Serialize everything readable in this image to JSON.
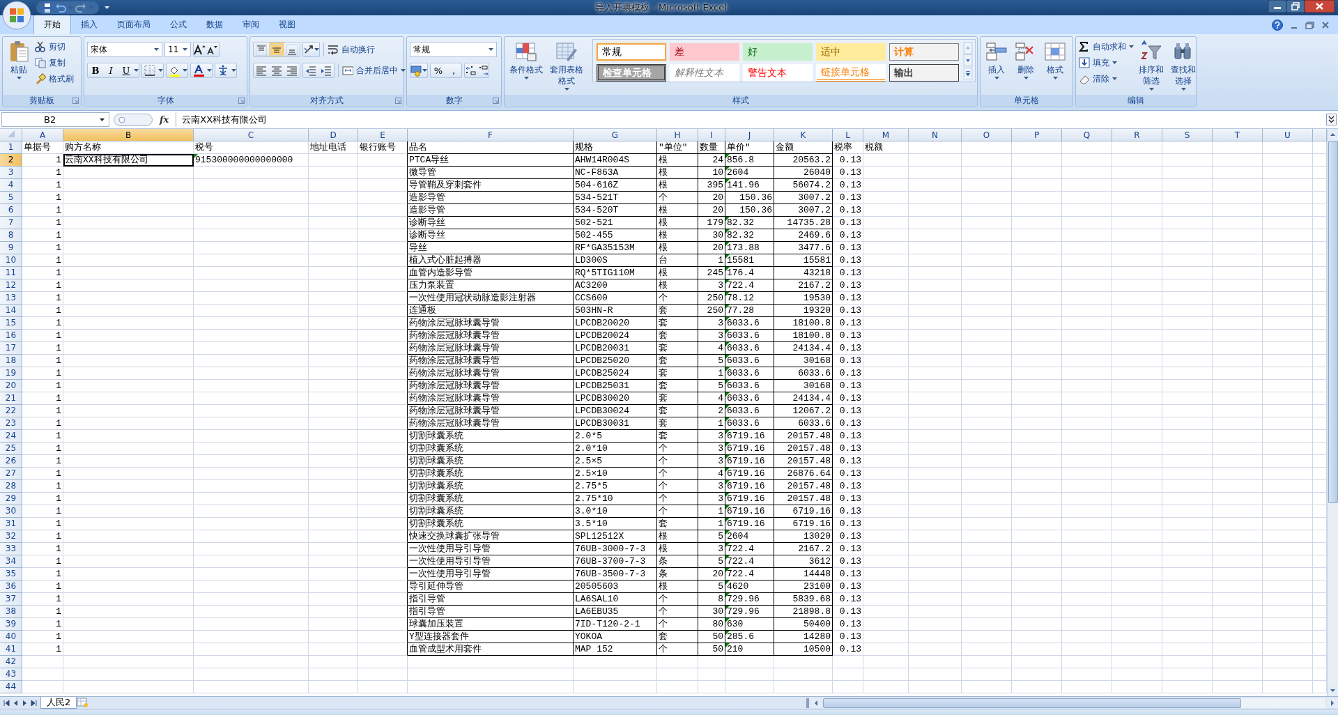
{
  "window": {
    "title": "导入开票模板 - Microsoft Excel"
  },
  "tabs": [
    {
      "label": "开始",
      "selected": true
    },
    {
      "label": "插入",
      "selected": false
    },
    {
      "label": "页面布局",
      "selected": false
    },
    {
      "label": "公式",
      "selected": false
    },
    {
      "label": "数据",
      "selected": false
    },
    {
      "label": "审阅",
      "selected": false
    },
    {
      "label": "视图",
      "selected": false
    }
  ],
  "ribbon": {
    "groups": [
      {
        "kind": "clipboard",
        "label": "剪贴板",
        "launcher": true,
        "paste": "粘贴",
        "items": [
          "剪切",
          "复制",
          "格式刷"
        ]
      },
      {
        "kind": "font",
        "label": "字体",
        "launcher": true,
        "font": "宋体",
        "size": "11",
        "styles": [
          "B",
          "I",
          "U"
        ]
      },
      {
        "kind": "alignment",
        "label": "对齐方式",
        "launcher": true,
        "vertical": [
          {
            "selected": false
          },
          {
            "selected": true
          },
          {
            "selected": false
          }
        ],
        "wrap": "自动换行",
        "merge": "合并后居中"
      },
      {
        "kind": "number",
        "label": "数字",
        "launcher": true,
        "format": "常规",
        "symbols": [
          "%",
          ","
        ]
      },
      {
        "kind": "styles",
        "label": "样式",
        "launcher": false,
        "buttons": [
          "条件格式",
          "套用表格格式"
        ],
        "cell_styles": [
          {
            "label": "常规",
            "kind": "normal",
            "selected": true
          },
          {
            "label": "差",
            "kind": "bad",
            "selected": false
          },
          {
            "label": "好",
            "kind": "good",
            "selected": false
          },
          {
            "label": "适中",
            "kind": "neutral",
            "selected": false
          },
          {
            "label": "计算",
            "kind": "calculation",
            "selected": false
          },
          {
            "label": "检查单元格",
            "kind": "check",
            "selected": false
          },
          {
            "label": "解释性文本",
            "kind": "explanatory",
            "selected": false
          },
          {
            "label": "警告文本",
            "kind": "warning",
            "selected": false
          },
          {
            "label": "链接单元格",
            "kind": "linked",
            "selected": false
          },
          {
            "label": "输出",
            "kind": "output",
            "selected": false
          }
        ]
      },
      {
        "kind": "cells",
        "label": "单元格",
        "launcher": false,
        "buttons": [
          "插入",
          "删除",
          "格式"
        ]
      },
      {
        "kind": "editing",
        "label": "编辑",
        "launcher": false,
        "items": [
          "自动求和",
          "填充",
          "清除"
        ],
        "buttons": [
          "排序和筛选",
          "查找和选择"
        ]
      }
    ]
  },
  "formula_bar": {
    "name_box": "B2",
    "fx": "fx",
    "value": "云南XX科技有限公司"
  },
  "sheet": {
    "columns": [
      {
        "letter": "A",
        "selected": false,
        "kind": "number",
        "boxed": false
      },
      {
        "letter": "B",
        "selected": true,
        "kind": "text",
        "boxed": false
      },
      {
        "letter": "C",
        "selected": false,
        "kind": "text_number",
        "boxed": false
      },
      {
        "letter": "D",
        "selected": false,
        "kind": "text",
        "boxed": false
      },
      {
        "letter": "E",
        "selected": false,
        "kind": "text",
        "boxed": false
      },
      {
        "letter": "F",
        "selected": false,
        "kind": "text",
        "boxed": true
      },
      {
        "letter": "G",
        "selected": false,
        "kind": "text",
        "boxed": true
      },
      {
        "letter": "H",
        "selected": false,
        "kind": "text",
        "boxed": true
      },
      {
        "letter": "I",
        "selected": false,
        "kind": "number",
        "boxed": true
      },
      {
        "letter": "J",
        "selected": false,
        "kind": "text_number",
        "boxed": true
      },
      {
        "letter": "K",
        "selected": false,
        "kind": "number",
        "boxed": true
      },
      {
        "letter": "L",
        "selected": false,
        "kind": "number",
        "boxed": false
      },
      {
        "letter": "M",
        "selected": false,
        "kind": "text",
        "boxed": false
      },
      {
        "letter": "N",
        "selected": false
      },
      {
        "letter": "O",
        "selected": false
      },
      {
        "letter": "P",
        "selected": false
      },
      {
        "letter": "Q",
        "selected": false
      },
      {
        "letter": "R",
        "selected": false
      },
      {
        "letter": "S",
        "selected": false
      },
      {
        "letter": "T",
        "selected": false
      },
      {
        "letter": "U",
        "selected": false
      }
    ],
    "rows": [
      {
        "number": "1",
        "selected": false,
        "cells": {
          "A": "单据号",
          "B": "购方名称",
          "C": "税号",
          "D": "地址电话",
          "E": "银行账号",
          "F": "品名",
          "G": "规格",
          "H": "″单位″",
          "I": "数量",
          "J": "单价″",
          "K": "金额",
          "L": "税率",
          "M": "税额"
        }
      },
      {
        "number": "2",
        "selected": true,
        "numbers_as_text": true,
        "cells": {
          "A": "1",
          "B": "云南XX科技有限公司",
          "C": "915300000000000000",
          "F": "PTCA导丝",
          "G": "AHW14R004S",
          "H": "根",
          "I": "24",
          "J": "856.8",
          "K": "20563.2",
          "L": "0.13"
        }
      },
      {
        "number": "3",
        "selected": false,
        "numbers_as_text": true,
        "cells": {
          "A": "1",
          "F": "微导管",
          "G": "NC-F863A",
          "H": "根",
          "I": "10",
          "J": "2604",
          "K": "26040",
          "L": "0.13"
        }
      },
      {
        "number": "4",
        "selected": false,
        "numbers_as_text": true,
        "cells": {
          "A": "1",
          "F": "导管鞘及穿刺套件",
          "G": "504-616Z",
          "H": "根",
          "I": "395",
          "J": "141.96",
          "K": "56074.2",
          "L": "0.13"
        }
      },
      {
        "number": "5",
        "selected": false,
        "numbers_as_text": false,
        "cells": {
          "A": "1",
          "F": "造影导管",
          "G": "534-521T",
          "H": "个",
          "I": "20",
          "J": "150.36",
          "K": "3007.2",
          "L": "0.13"
        }
      },
      {
        "number": "6",
        "selected": false,
        "numbers_as_text": false,
        "cells": {
          "A": "1",
          "F": "造影导管",
          "G": "534-520T",
          "H": "根",
          "I": "20",
          "J": "150.36",
          "K": "3007.2",
          "L": "0.13"
        }
      },
      {
        "number": "7",
        "selected": false,
        "numbers_as_text": true,
        "cells": {
          "A": "1",
          "F": "诊断导丝",
          "G": "502-521",
          "H": "根",
          "I": "179",
          "J": "82.32",
          "K": "14735.28",
          "L": "0.13"
        }
      },
      {
        "number": "8",
        "selected": false,
        "numbers_as_text": true,
        "cells": {
          "A": "1",
          "F": "诊断导丝",
          "G": "502-455",
          "H": "根",
          "I": "30",
          "J": "82.32",
          "K": "2469.6",
          "L": "0.13"
        }
      },
      {
        "number": "9",
        "selected": false,
        "numbers_as_text": true,
        "cells": {
          "A": "1",
          "F": "导丝",
          "G": "RF*GA35153M",
          "H": "根",
          "I": "20",
          "J": "173.88",
          "K": "3477.6",
          "L": "0.13"
        }
      },
      {
        "number": "10",
        "selected": false,
        "numbers_as_text": true,
        "cells": {
          "A": "1",
          "F": "植入式心脏起搏器",
          "G": "LD300S",
          "H": "台",
          "I": "1",
          "J": "15581",
          "K": "15581",
          "L": "0.13"
        }
      },
      {
        "number": "11",
        "selected": false,
        "numbers_as_text": true,
        "cells": {
          "A": "1",
          "F": "血管内造影导管",
          "G": "RQ*5TIG110M",
          "H": "根",
          "I": "245",
          "J": "176.4",
          "K": "43218",
          "L": "0.13"
        }
      },
      {
        "number": "12",
        "selected": false,
        "numbers_as_text": true,
        "cells": {
          "A": "1",
          "F": "压力泵装置",
          "G": "AC3200",
          "H": "根",
          "I": "3",
          "J": "722.4",
          "K": "2167.2",
          "L": "0.13"
        }
      },
      {
        "number": "13",
        "selected": false,
        "numbers_as_text": true,
        "cells": {
          "A": "1",
          "F": "一次性使用冠状动脉造影注射器",
          "G": "CCS600",
          "H": "个",
          "I": "250",
          "J": "78.12",
          "K": "19530",
          "L": "0.13"
        }
      },
      {
        "number": "14",
        "selected": false,
        "numbers_as_text": true,
        "cells": {
          "A": "1",
          "F": "连通板",
          "G": "503HN-R",
          "H": "套",
          "I": "250",
          "J": "77.28",
          "K": "19320",
          "L": "0.13"
        }
      },
      {
        "number": "15",
        "selected": false,
        "numbers_as_text": true,
        "cells": {
          "A": "1",
          "F": "药物涂层冠脉球囊导管",
          "G": "LPCDB20020",
          "H": "套",
          "I": "3",
          "J": "6033.6",
          "K": "18100.8",
          "L": "0.13"
        }
      },
      {
        "number": "16",
        "selected": false,
        "numbers_as_text": true,
        "cells": {
          "A": "1",
          "F": "药物涂层冠脉球囊导管",
          "G": "LPCDB20024",
          "H": "套",
          "I": "3",
          "J": "6033.6",
          "K": "18100.8",
          "L": "0.13"
        }
      },
      {
        "number": "17",
        "selected": false,
        "numbers_as_text": true,
        "cells": {
          "A": "1",
          "F": "药物涂层冠脉球囊导管",
          "G": "LPCDB20031",
          "H": "套",
          "I": "4",
          "J": "6033.6",
          "K": "24134.4",
          "L": "0.13"
        }
      },
      {
        "number": "18",
        "selected": false,
        "numbers_as_text": true,
        "cells": {
          "A": "1",
          "F": "药物涂层冠脉球囊导管",
          "G": "LPCDB25020",
          "H": "套",
          "I": "5",
          "J": "6033.6",
          "K": "30168",
          "L": "0.13"
        }
      },
      {
        "number": "19",
        "selected": false,
        "numbers_as_text": true,
        "cells": {
          "A": "1",
          "F": "药物涂层冠脉球囊导管",
          "G": "LPCDB25024",
          "H": "套",
          "I": "1",
          "J": "6033.6",
          "K": "6033.6",
          "L": "0.13"
        }
      },
      {
        "number": "20",
        "selected": false,
        "numbers_as_text": true,
        "cells": {
          "A": "1",
          "F": "药物涂层冠脉球囊导管",
          "G": "LPCDB25031",
          "H": "套",
          "I": "5",
          "J": "6033.6",
          "K": "30168",
          "L": "0.13"
        }
      },
      {
        "number": "21",
        "selected": false,
        "numbers_as_text": true,
        "cells": {
          "A": "1",
          "F": "药物涂层冠脉球囊导管",
          "G": "LPCDB30020",
          "H": "套",
          "I": "4",
          "J": "6033.6",
          "K": "24134.4",
          "L": "0.13"
        }
      },
      {
        "number": "22",
        "selected": false,
        "numbers_as_text": true,
        "cells": {
          "A": "1",
          "F": "药物涂层冠脉球囊导管",
          "G": "LPCDB30024",
          "H": "套",
          "I": "2",
          "J": "6033.6",
          "K": "12067.2",
          "L": "0.13"
        }
      },
      {
        "number": "23",
        "selected": false,
        "numbers_as_text": true,
        "cells": {
          "A": "1",
          "F": "药物涂层冠脉球囊导管",
          "G": "LPCDB30031",
          "H": "套",
          "I": "1",
          "J": "6033.6",
          "K": "6033.6",
          "L": "0.13"
        }
      },
      {
        "number": "24",
        "selected": false,
        "numbers_as_text": true,
        "cells": {
          "A": "1",
          "F": "切割球囊系统",
          "G": "2.0*5",
          "H": "套",
          "I": "3",
          "J": "6719.16",
          "K": "20157.48",
          "L": "0.13"
        }
      },
      {
        "number": "25",
        "selected": false,
        "numbers_as_text": true,
        "cells": {
          "A": "1",
          "F": "切割球囊系统",
          "G": "2.0*10",
          "H": "个",
          "I": "3",
          "J": "6719.16",
          "K": "20157.48",
          "L": "0.13"
        }
      },
      {
        "number": "26",
        "selected": false,
        "numbers_as_text": true,
        "cells": {
          "A": "1",
          "F": "切割球囊系统",
          "G": "2.5×5",
          "H": "个",
          "I": "3",
          "J": "6719.16",
          "K": "20157.48",
          "L": "0.13"
        }
      },
      {
        "number": "27",
        "selected": false,
        "numbers_as_text": true,
        "cells": {
          "A": "1",
          "F": "切割球囊系统",
          "G": "2.5×10",
          "H": "个",
          "I": "4",
          "J": "6719.16",
          "K": "26876.64",
          "L": "0.13"
        }
      },
      {
        "number": "28",
        "selected": false,
        "numbers_as_text": true,
        "cells": {
          "A": "1",
          "F": "切割球囊系统",
          "G": "2.75*5",
          "H": "个",
          "I": "3",
          "J": "6719.16",
          "K": "20157.48",
          "L": "0.13"
        }
      },
      {
        "number": "29",
        "selected": false,
        "numbers_as_text": true,
        "cells": {
          "A": "1",
          "F": "切割球囊系统",
          "G": "2.75*10",
          "H": "个",
          "I": "3",
          "J": "6719.16",
          "K": "20157.48",
          "L": "0.13"
        }
      },
      {
        "number": "30",
        "selected": false,
        "numbers_as_text": true,
        "cells": {
          "A": "1",
          "F": "切割球囊系统",
          "G": "3.0*10",
          "H": "个",
          "I": "1",
          "J": "6719.16",
          "K": "6719.16",
          "L": "0.13"
        }
      },
      {
        "number": "31",
        "selected": false,
        "numbers_as_text": true,
        "cells": {
          "A": "1",
          "F": "切割球囊系统",
          "G": "3.5*10",
          "H": "套",
          "I": "1",
          "J": "6719.16",
          "K": "6719.16",
          "L": "0.13"
        }
      },
      {
        "number": "32",
        "selected": false,
        "numbers_as_text": true,
        "cells": {
          "A": "1",
          "F": "快速交换球囊扩张导管",
          "G": "SPL12512X",
          "H": "根",
          "I": "5",
          "J": "2604",
          "K": "13020",
          "L": "0.13"
        }
      },
      {
        "number": "33",
        "selected": false,
        "numbers_as_text": true,
        "cells": {
          "A": "1",
          "F": "一次性使用导引导管",
          "G": "76UB-3000-7-3",
          "H": "根",
          "I": "3",
          "J": "722.4",
          "K": "2167.2",
          "L": "0.13"
        }
      },
      {
        "number": "34",
        "selected": false,
        "numbers_as_text": true,
        "cells": {
          "A": "1",
          "F": "一次性使用导引导管",
          "G": "76UB-3700-7-3",
          "H": "条",
          "I": "5",
          "J": "722.4",
          "K": "3612",
          "L": "0.13"
        }
      },
      {
        "number": "35",
        "selected": false,
        "numbers_as_text": true,
        "cells": {
          "A": "1",
          "F": "一次性使用导引导管",
          "G": "76UB-3500-7-3",
          "H": "条",
          "I": "20",
          "J": "722.4",
          "K": "14448",
          "L": "0.13"
        }
      },
      {
        "number": "36",
        "selected": false,
        "numbers_as_text": true,
        "cells": {
          "A": "1",
          "F": "导引延伸导管",
          "G": "20505603",
          "H": "根",
          "I": "5",
          "J": "4620",
          "K": "23100",
          "L": "0.13"
        }
      },
      {
        "number": "37",
        "selected": false,
        "numbers_as_text": true,
        "cells": {
          "A": "1",
          "F": "指引导管",
          "G": "LA6SAL10",
          "H": "个",
          "I": "8",
          "J": "729.96",
          "K": "5839.68",
          "L": "0.13"
        }
      },
      {
        "number": "38",
        "selected": false,
        "numbers_as_text": true,
        "cells": {
          "A": "1",
          "F": "指引导管",
          "G": "LA6EBU35",
          "H": "个",
          "I": "30",
          "J": "729.96",
          "K": "21898.8",
          "L": "0.13"
        }
      },
      {
        "number": "39",
        "selected": false,
        "numbers_as_text": true,
        "cells": {
          "A": "1",
          "F": "球囊加压装置",
          "G": "7ID-T120-2-1",
          "H": "个",
          "I": "80",
          "J": "630",
          "K": "50400",
          "L": "0.13"
        }
      },
      {
        "number": "40",
        "selected": false,
        "numbers_as_text": true,
        "cells": {
          "A": "1",
          "F": "Y型连接器套件",
          "G": "YOKOA",
          "H": "套",
          "I": "50",
          "J": "285.6",
          "K": "14280",
          "L": "0.13"
        }
      },
      {
        "number": "41",
        "selected": false,
        "numbers_as_text": true,
        "cells": {
          "A": "1",
          "F": "血管成型术用套件",
          "G": "MAP 152",
          "H": "个",
          "I": "50",
          "J": "210",
          "K": "10500",
          "L": "0.13"
        }
      },
      {
        "number": "42",
        "selected": false
      },
      {
        "number": "43",
        "selected": false
      },
      {
        "number": "44",
        "selected": false
      }
    ]
  },
  "sheet_tabs": [
    {
      "label": "人民2",
      "selected": true
    }
  ]
}
